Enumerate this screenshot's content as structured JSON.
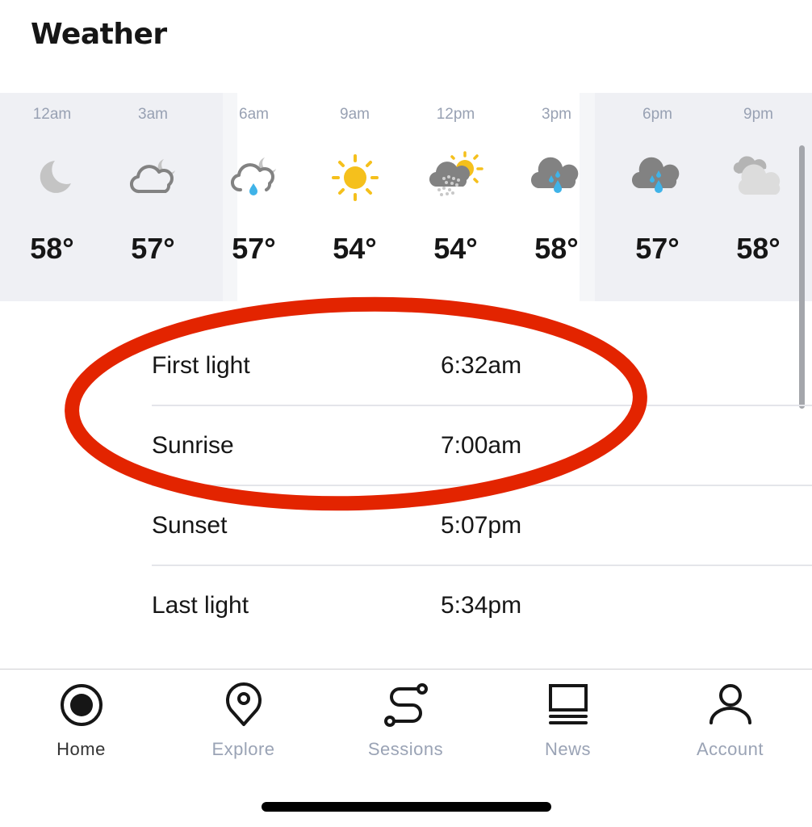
{
  "header": {
    "title": "Weather"
  },
  "forecast": {
    "hours": [
      {
        "time": "12am",
        "icon": "moon-icon",
        "temp": "58°",
        "night": true
      },
      {
        "time": "3am",
        "icon": "cloud-moon-icon",
        "temp": "57°",
        "night": true
      },
      {
        "time": "6am",
        "icon": "cloud-moon-rain-icon",
        "temp": "57°",
        "night": false
      },
      {
        "time": "9am",
        "icon": "sun-icon",
        "temp": "54°",
        "night": false
      },
      {
        "time": "12pm",
        "icon": "sun-cloud-hail-icon",
        "temp": "54°",
        "night": false
      },
      {
        "time": "3pm",
        "icon": "cloud-rain-icon",
        "temp": "58°",
        "night": false
      },
      {
        "time": "6pm",
        "icon": "cloud-rain-icon",
        "temp": "57°",
        "night": true
      },
      {
        "time": "9pm",
        "icon": "clouds-icon",
        "temp": "58°",
        "night": true
      }
    ]
  },
  "sun_times": {
    "rows": [
      {
        "label": "First light",
        "value": "6:32am"
      },
      {
        "label": "Sunrise",
        "value": "7:00am"
      },
      {
        "label": "Sunset",
        "value": "5:07pm"
      },
      {
        "label": "Last light",
        "value": "5:34pm"
      }
    ]
  },
  "annotation": {
    "color": "#e32400",
    "target": "First light and Sunrise"
  },
  "tabbar": {
    "items": [
      {
        "label": "Home",
        "icon": "home-target-icon",
        "active": true
      },
      {
        "label": "Explore",
        "icon": "map-pin-icon",
        "active": false
      },
      {
        "label": "Sessions",
        "icon": "route-icon",
        "active": false
      },
      {
        "label": "News",
        "icon": "news-icon",
        "active": false
      },
      {
        "label": "Account",
        "icon": "person-icon",
        "active": false
      }
    ]
  },
  "colors": {
    "sun": "#f5c01c",
    "rain": "#3fb3e8",
    "cloud_dark": "#828282",
    "cloud_light": "#dcdcdc",
    "inactive_tab": "#9aa3b5",
    "night_shade": "#eff0f4"
  }
}
